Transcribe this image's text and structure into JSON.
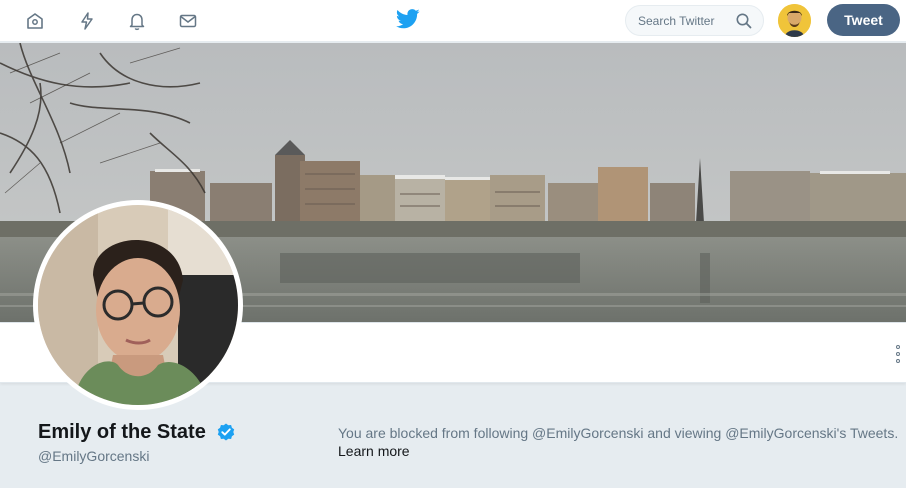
{
  "nav": {
    "icons": [
      "home-icon",
      "moments-icon",
      "notifications-icon",
      "messages-icon"
    ],
    "logo": "twitter-bird-icon",
    "search_placeholder": "Search Twitter",
    "tweet_label": "Tweet"
  },
  "profile": {
    "name": "Emily of the State",
    "handle": "@EmilyGorcenski",
    "verified": true
  },
  "blocked": {
    "message": "You are blocked from following @EmilyGorcenski and viewing @EmilyGorcenski's Tweets.",
    "learn_more": "Learn more"
  },
  "colors": {
    "accent": "#1da1f2",
    "tweet_button": "#4a6584",
    "page_bg": "#e6ecf0"
  }
}
